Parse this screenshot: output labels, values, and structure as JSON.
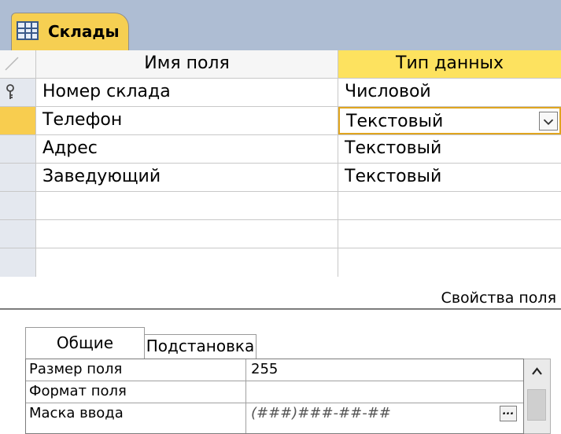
{
  "tab": {
    "title": "Склады",
    "icon": "table-icon"
  },
  "grid": {
    "headers": {
      "field_name": "Имя поля",
      "data_type": "Тип данных"
    },
    "rows": [
      {
        "name": "Номер склада",
        "type": "Числовой",
        "primary_key": true
      },
      {
        "name": "Телефон",
        "type": "Текстовый",
        "active": true
      },
      {
        "name": "Адрес",
        "type": "Текстовый"
      },
      {
        "name": "Заведующий",
        "type": "Текстовый"
      },
      {
        "name": "",
        "type": ""
      },
      {
        "name": "",
        "type": ""
      }
    ]
  },
  "properties": {
    "title": "Свойства поля",
    "tabs": [
      "Общие",
      "Подстановка"
    ],
    "active_tab": "Общие",
    "rows": [
      {
        "label": "Размер поля",
        "value": "255"
      },
      {
        "label": "Формат поля",
        "value": ""
      },
      {
        "label": "Маска ввода",
        "value": "(###)###-##-##"
      }
    ],
    "builder_button": "..."
  },
  "colors": {
    "tab_bg": "#aebdd3",
    "active_tab": "#f6cf52",
    "header_highlight": "#fde25f",
    "selector_active": "#f8cd4f"
  }
}
